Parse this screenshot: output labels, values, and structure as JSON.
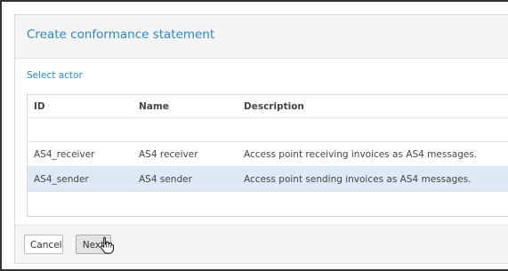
{
  "dialog": {
    "title": "Create conformance statement",
    "section_label": "Select actor"
  },
  "table": {
    "columns": [
      "ID",
      "Name",
      "Description"
    ],
    "rows": [
      {
        "id": "AS4_receiver",
        "name": "AS4 receiver",
        "description": "Access point receiving invoices as AS4 messages.",
        "selected": false
      },
      {
        "id": "AS4_sender",
        "name": "AS4 sender",
        "description": "Access point sending invoices as AS4 messages.",
        "selected": true
      }
    ]
  },
  "footer": {
    "cancel_label": "Cancel",
    "next_label": "Next"
  },
  "colors": {
    "accent": "#2a88c9",
    "selected_row": "#dde9f5"
  },
  "icons": {
    "cursor": "hand-pointer-icon"
  }
}
